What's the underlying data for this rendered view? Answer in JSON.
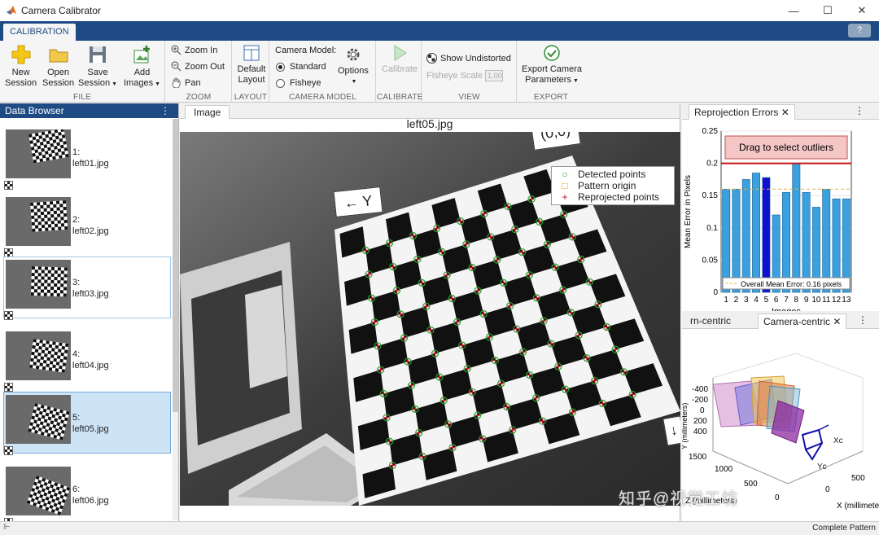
{
  "window": {
    "title": "Camera Calibrator",
    "minimize": "—",
    "maximize": "☐",
    "close": "✕"
  },
  "ribbon_tab": "CALIBRATION",
  "help": "?",
  "file": {
    "new": [
      "New",
      "Session"
    ],
    "open": [
      "Open",
      "Session"
    ],
    "save": [
      "Save",
      "Session"
    ],
    "add": [
      "Add",
      "Images"
    ],
    "label": "FILE"
  },
  "zoom": {
    "in": "Zoom In",
    "out": "Zoom Out",
    "pan": "Pan",
    "label": "ZOOM"
  },
  "layout": {
    "default": [
      "Default",
      "Layout"
    ],
    "label": "LAYOUT"
  },
  "camera_model": {
    "title": "Camera Model:",
    "standard": "Standard",
    "fisheye": "Fisheye",
    "options": "Options",
    "label": "CAMERA MODEL",
    "selected": "Standard"
  },
  "calibrate": {
    "button": "Calibrate",
    "label": "CALIBRATE"
  },
  "view": {
    "show_undistorted": "Show Undistorted",
    "fisheye_scale": "Fisheye Scale",
    "scale_value": "1.00",
    "label": "VIEW"
  },
  "export": {
    "button": [
      "Export Camera",
      "Parameters"
    ],
    "label": "EXPORT"
  },
  "data_browser": {
    "title": "Data Browser",
    "items": [
      {
        "index": "1:",
        "file": "left01.jpg"
      },
      {
        "index": "2:",
        "file": "left02.jpg"
      },
      {
        "index": "3:",
        "file": "left03.jpg"
      },
      {
        "index": "4:",
        "file": "left04.jpg"
      },
      {
        "index": "5:",
        "file": "left05.jpg"
      },
      {
        "index": "6:",
        "file": "left06.jpg"
      }
    ],
    "selected": "5:"
  },
  "image_panel": {
    "tab": "Image",
    "image_title": "left05.jpg",
    "origin_callout": "(0,0)",
    "y_callout": "← Y",
    "x_callout": "↓",
    "legend": [
      {
        "symbol": "○",
        "label": "Detected points",
        "color": "#2ca02c"
      },
      {
        "symbol": "□",
        "label": "Pattern origin",
        "color": "#e0a800"
      },
      {
        "symbol": "+",
        "label": "Reprojected points",
        "color": "#c0102a"
      }
    ]
  },
  "reprojection": {
    "tab": "Reprojection Errors",
    "outlier_box": "Drag to select outliers",
    "legend": "Overall Mean Error: 0.16 pixels"
  },
  "chart_data": {
    "type": "bar",
    "categories": [
      "1",
      "2",
      "3",
      "4",
      "5",
      "6",
      "7",
      "8",
      "9",
      "10",
      "11",
      "12",
      "13"
    ],
    "values": [
      0.16,
      0.16,
      0.175,
      0.185,
      0.178,
      0.12,
      0.155,
      0.2,
      0.155,
      0.132,
      0.16,
      0.145,
      0.145
    ],
    "highlighted": "5",
    "mean": 0.16,
    "threshold": 0.2,
    "title": "",
    "xlabel": "Images",
    "ylabel": "Mean Error in Pixels",
    "ylim": [
      0,
      0.25
    ],
    "yticks": [
      "0",
      "0.05",
      "0.1",
      "0.15",
      "0.2",
      "0.25"
    ],
    "bar_color": "#3aa0e0",
    "highlight_color": "#1010d0",
    "grid": true
  },
  "extrinsics": {
    "tab_partial": "rn-centric",
    "tab_active": "Camera-centric",
    "ylabel": "Y (millimeters)",
    "zlabel": "Z (millimeters)",
    "xlabel": "X (millimeters)",
    "yticks": [
      "-400",
      "-200",
      "0",
      "200",
      "400"
    ],
    "zticks": [
      "1500",
      "1000",
      "500",
      "0"
    ],
    "xticks": [
      "500",
      "0"
    ],
    "xc": "Xc",
    "yc": "Yc"
  },
  "status": {
    "right": "Complete Pattern",
    "left": "⊩"
  },
  "watermark": "知乎@视觉工坊"
}
